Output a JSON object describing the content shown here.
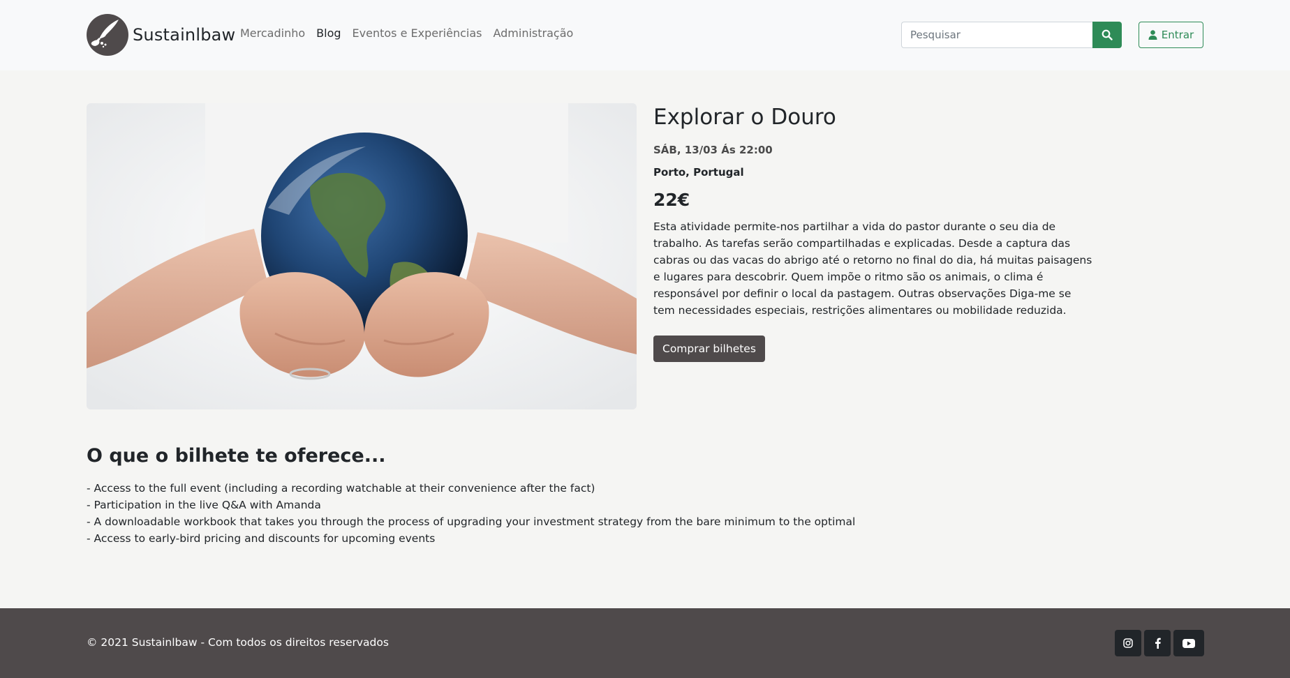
{
  "brand": {
    "name": "Sustainlbaw",
    "logo_icon": "leaf-logo-icon"
  },
  "nav": {
    "items": [
      {
        "label": "Mercadinho",
        "active": false
      },
      {
        "label": "Blog",
        "active": true
      },
      {
        "label": "Eventos e Experiências",
        "active": false
      },
      {
        "label": "Administração",
        "active": false
      }
    ]
  },
  "search": {
    "placeholder": "Pesquisar",
    "value": "",
    "icon": "search-icon"
  },
  "login": {
    "label": "Entrar",
    "icon": "user-icon"
  },
  "event": {
    "image_alt": "Hands holding the Earth",
    "title": "Explorar o Douro",
    "date": "SÁB, 13/03 Ás 22:00",
    "location": "Porto, Portugal",
    "price": "22€",
    "description": "Esta atividade permite-nos partilhar a vida do pastor durante o seu dia de trabalho. As tarefas serão compartilhadas e explicadas. Desde a captura das cabras ou das vacas do abrigo até o retorno no final do dia, há muitas paisagens e lugares para descobrir. Quem impõe o ritmo são os animais, o clima é responsável por definir o local da pastagem. Outras observações Diga-me se tem necessidades especiais, restrições alimentares ou mobilidade reduzida.",
    "buy_label": "Comprar bilhetes"
  },
  "offer": {
    "title": "O que o bilhete te oferece...",
    "items": [
      "- Access to the full event (including a recording watchable at their convenience after the fact)",
      "- Participation in the live Q&A with Amanda",
      "- A downloadable workbook that takes you through the process of upgrading your investment strategy from the bare minimum to the optimal",
      "- Access to early-bird pricing and discounts for upcoming events"
    ]
  },
  "footer": {
    "copyright": "© 2021 Sustainlbaw - Com todos os direitos reservados",
    "socials": [
      "instagram-icon",
      "facebook-icon",
      "youtube-icon"
    ]
  },
  "colors": {
    "accent": "#2e8b57",
    "dark": "#4f4a4b",
    "page_bg": "#f5f5f3",
    "nav_bg": "#f8f9fa"
  }
}
